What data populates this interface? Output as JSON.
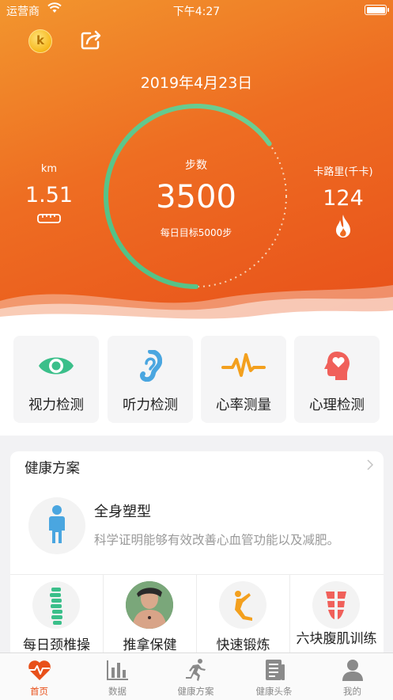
{
  "status_bar": {
    "carrier": "运营商",
    "time": "下午4:27"
  },
  "header": {
    "coin_letter": "k",
    "date": "2019年4月23日"
  },
  "steps": {
    "label": "步数",
    "value": "3500",
    "goal": "每日目标5000步",
    "progress": 0.7
  },
  "distance": {
    "unit": "km",
    "value": "1.51"
  },
  "calories": {
    "unit": "卡路里(千卡)",
    "value": "124"
  },
  "tests": [
    {
      "label": "视力检测",
      "icon": "eye-icon"
    },
    {
      "label": "听力检测",
      "icon": "ear-icon"
    },
    {
      "label": "心率测量",
      "icon": "heartbeat-icon"
    },
    {
      "label": "心理检测",
      "icon": "brain-heart-icon"
    }
  ],
  "plan": {
    "title": "健康方案",
    "featured": {
      "title": "全身塑型",
      "subtitle": "科学证明能够有效改善心血管功能以及减肥。",
      "icon": "body-icon"
    },
    "items": [
      {
        "label": "每日颈椎操",
        "icon": "spine-icon"
      },
      {
        "label": "推拿保健",
        "icon": "massage-photo"
      },
      {
        "label": "快速锻炼",
        "icon": "stretch-icon"
      },
      {
        "label": "六块腹肌训练",
        "icon": "abs-icon"
      }
    ]
  },
  "tabs": [
    {
      "label": "首页",
      "icon": "heart-pulse-icon",
      "active": true
    },
    {
      "label": "数据",
      "icon": "bar-chart-icon",
      "active": false
    },
    {
      "label": "健康方案",
      "icon": "runner-icon",
      "active": false
    },
    {
      "label": "健康头条",
      "icon": "news-icon",
      "active": false
    },
    {
      "label": "我的",
      "icon": "user-icon",
      "active": false
    }
  ],
  "colors": {
    "accent": "#e8501a",
    "ring_start": "#5cc7b6",
    "ring_end": "#3ec06a",
    "icon_green": "#3bbf8a",
    "icon_blue": "#4aa6e0",
    "icon_orange": "#f3a01e",
    "icon_red": "#f0605a"
  }
}
